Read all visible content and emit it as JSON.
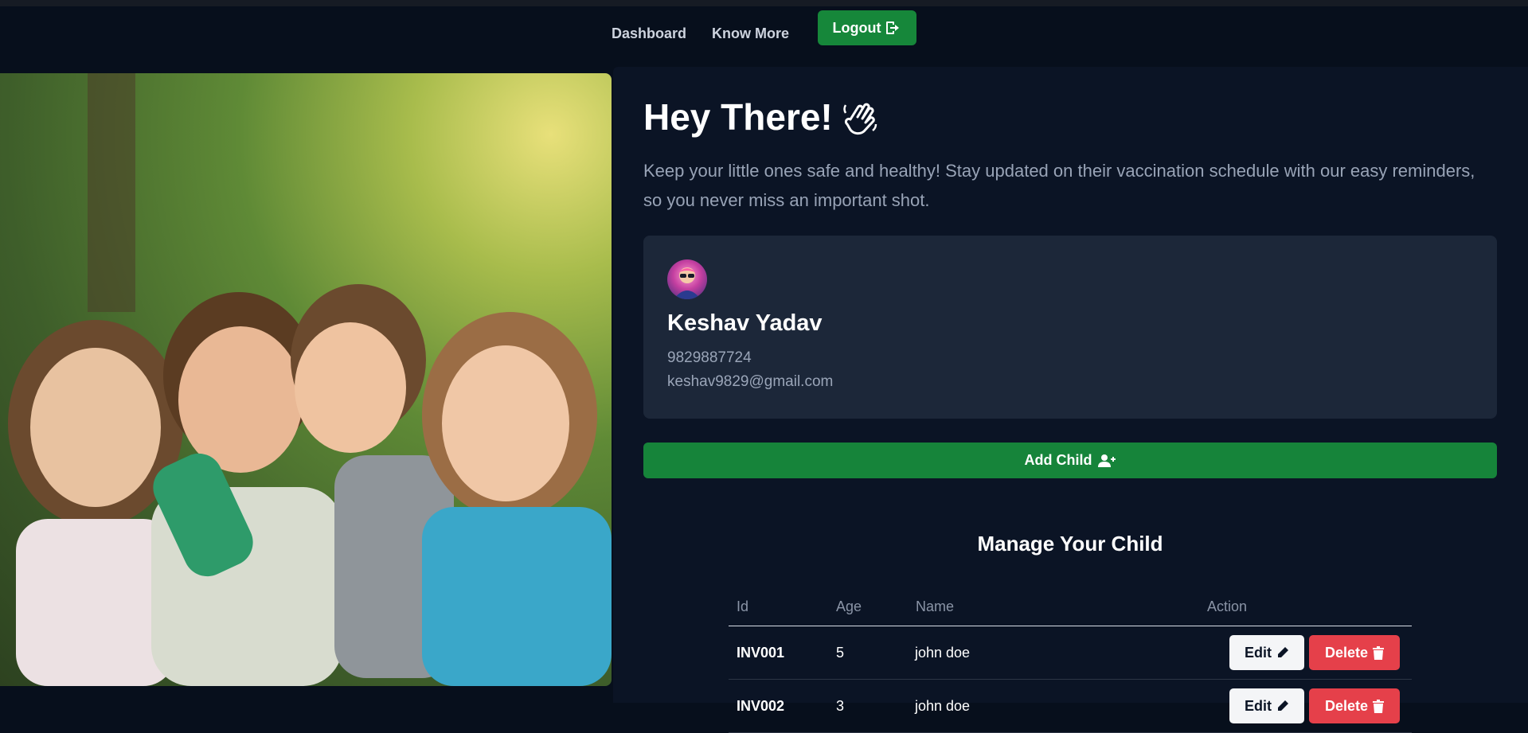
{
  "nav": {
    "dashboard": "Dashboard",
    "know_more": "Know More",
    "logout": "Logout",
    "logout_icon": "logout-icon"
  },
  "hero": {
    "image": "children-group-photo"
  },
  "welcome": {
    "greeting": "Hey There!",
    "greeting_icon": "waving-hand-icon",
    "subtitle": "Keep your little ones safe and healthy! Stay updated on their vaccination schedule with our easy reminders, so you never miss an important shot."
  },
  "profile": {
    "name": "Keshav Yadav",
    "phone": "9829887724",
    "email": "keshav9829@gmail.com"
  },
  "add_child": {
    "label": "Add Child",
    "icon": "user-plus-icon"
  },
  "manage": {
    "title": "Manage Your Child",
    "columns": [
      "Id",
      "Age",
      "Name",
      "Action"
    ],
    "rows": [
      {
        "id": "INV001",
        "age": "5",
        "name": "john doe"
      },
      {
        "id": "INV002",
        "age": "3",
        "name": "john doe"
      }
    ],
    "edit_label": "Edit",
    "delete_label": "Delete"
  },
  "colors": {
    "background": "#070f1c",
    "panel": "#0b1425",
    "card": "#1c2739",
    "primary_green": "#16843a",
    "danger_red": "#e5404a"
  }
}
